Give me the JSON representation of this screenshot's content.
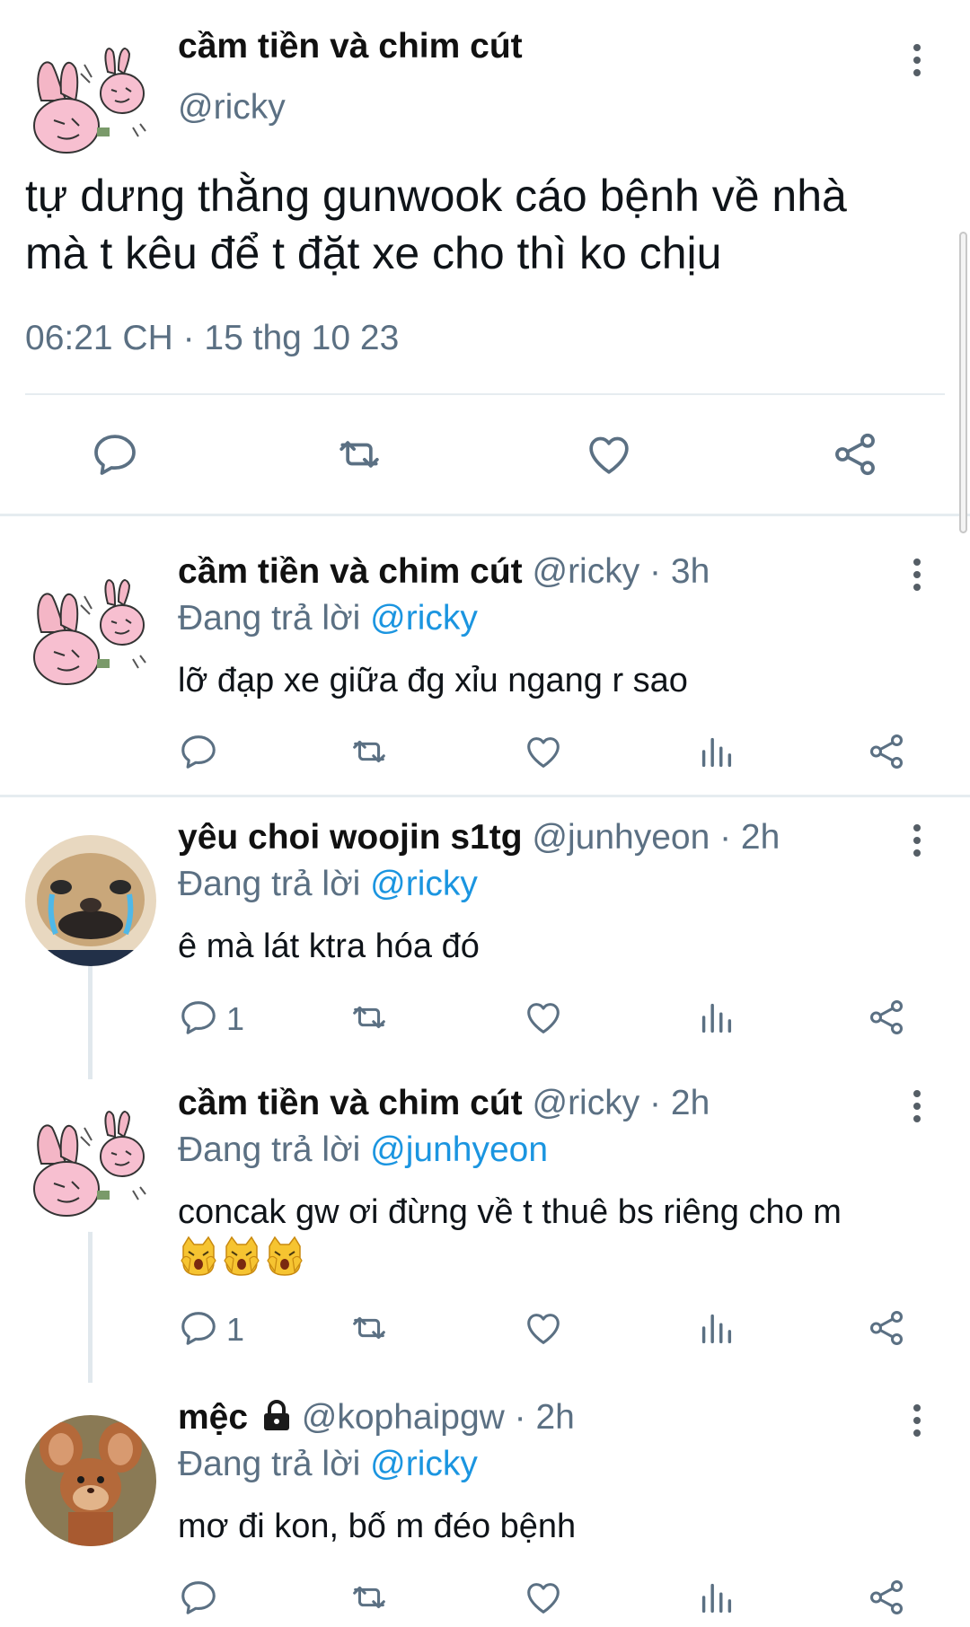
{
  "main_tweet": {
    "author_name": "cầm tiền và chim cút",
    "author_handle": "@ricky",
    "text_line_1": "tự dưng thằng gunwook cáo bệnh về nhà",
    "text_line_2": "mà t kêu để t đặt xe cho thì ko chịu",
    "timestamp": "06:21 CH · 15 thg 10 23",
    "actions": [
      "reply-icon",
      "retweet-icon",
      "like-icon",
      "share-icon"
    ]
  },
  "replies": [
    {
      "author_name": "cầm tiền và chim cút",
      "meta": " @ricky · 3h",
      "replying_prefix": "Đang trả lời ",
      "replying_to": "@ricky",
      "text": "lỡ đạp xe giữa đg xỉu ngang r sao",
      "reply_count": "",
      "avatar": "pink-bunny-avatar"
    },
    {
      "author_name": "yêu choi woojin s1tg",
      "meta": " @junhyeon · 2h",
      "replying_prefix": "Đang trả lời ",
      "replying_to": "@ricky",
      "text": "ê mà lát ktra hóa đó",
      "reply_count": "1",
      "avatar": "crying-dog-avatar"
    },
    {
      "author_name": "cầm tiền và chim cút",
      "meta": " @ricky · 2h",
      "replying_prefix": "Đang trả lời ",
      "replying_to": "@junhyeon",
      "text": "concak gw ơi đừng về t thuê bs riêng cho m",
      "reply_count": "1",
      "avatar": "pink-bunny-avatar",
      "emojis": [
        "weary-cat-emoji",
        "weary-cat-emoji",
        "weary-cat-emoji"
      ]
    },
    {
      "author_name": "mệc",
      "meta": " @kophaipgw · 2h",
      "replying_prefix": "Đang trả lời ",
      "replying_to": "@ricky",
      "text": "mơ đi kon, bố m đéo bệnh",
      "reply_count": "",
      "avatar": "brown-mouse-avatar",
      "locked": true
    }
  ],
  "colors": {
    "text_primary": "#0f1419",
    "text_secondary": "#5b7083",
    "link": "#1b95e0",
    "divider": "#e6ecf0",
    "icon": "#5b7083"
  }
}
